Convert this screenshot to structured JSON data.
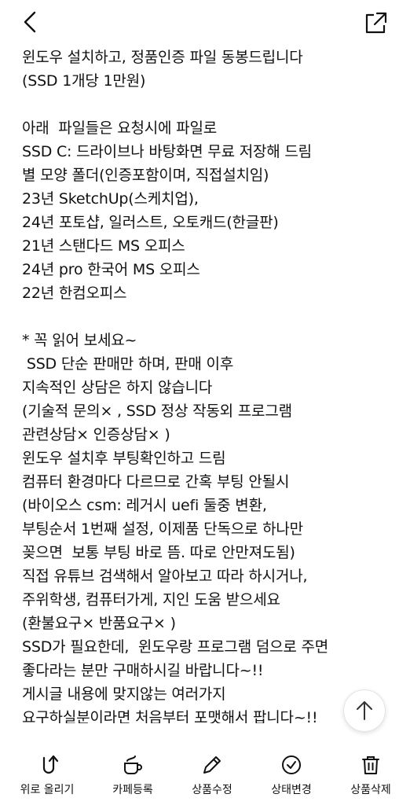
{
  "header": {
    "back_icon": "chevron-left-icon",
    "share_icon": "external-link-icon"
  },
  "body_lines": [
    "윈도우 설치하고, 정품인증 파일 동봉드립니다",
    "(SSD 1개당 1만원)",
    "",
    "아래  파일들은 요청시에 파일로",
    "SSD C: 드라이브나 바탕화면 무료 저장해 드림",
    "별 모양 폴더(인증포함이며, 직접설치임)",
    "23년 SketchUp(스케치업),",
    "24년 포토샵, 일러스트, 오토캐드(한글판)",
    "21년 스탠다드 MS 오피스",
    "24년 pro 한국어 MS 오피스",
    "22년 한컴오피스",
    "",
    "* 꼭 읽어 보세요~",
    " SSD 단순 판매만 하며, 판매 이후",
    "지속적인 상담은 하지 않습니다",
    "(기술적 문의× , SSD 정상 작동외 프로그램",
    "관련상담× 인증상담× )",
    "윈도우 설치후 부팅확인하고 드림",
    "컴퓨터 환경마다 다르므로 간혹 부팅 안될시",
    "(바이오스 csm: 레거시 uefi 둘중 변환,",
    "부팅순서 1번째 설정, 이제품 단독으로 하나만",
    "꽂으면  보통 부팅 바로 뜸. 따로 안만져도됨)",
    "직접 유튜브 검색해서 알아보고 따라 하시거나,",
    "주위학생, 컴퓨터가게, 지인 도움 받으세요",
    "(환불요구× 반품요구× )",
    "SSD가 필요한데,  윈도우랑 프로그램 덤으로 주면",
    "좋다라는 분만 구매하시길 바랍니다~!!",
    "게시글 내용에 맞지않는 여러가지",
    "요구하실분이라면 처음부터 포맷해서 팝니다~!!"
  ],
  "scroll_top": {
    "icon": "arrow-up-icon"
  },
  "bottom_bar": {
    "items": [
      {
        "label": "위로 올리기",
        "icon": "bump-up-icon"
      },
      {
        "label": "카페등록",
        "icon": "coffee-cup-icon"
      },
      {
        "label": "상품수정",
        "icon": "pencil-icon"
      },
      {
        "label": "상태변경",
        "icon": "check-circle-icon"
      },
      {
        "label": "상품삭제",
        "icon": "trash-icon"
      }
    ]
  }
}
